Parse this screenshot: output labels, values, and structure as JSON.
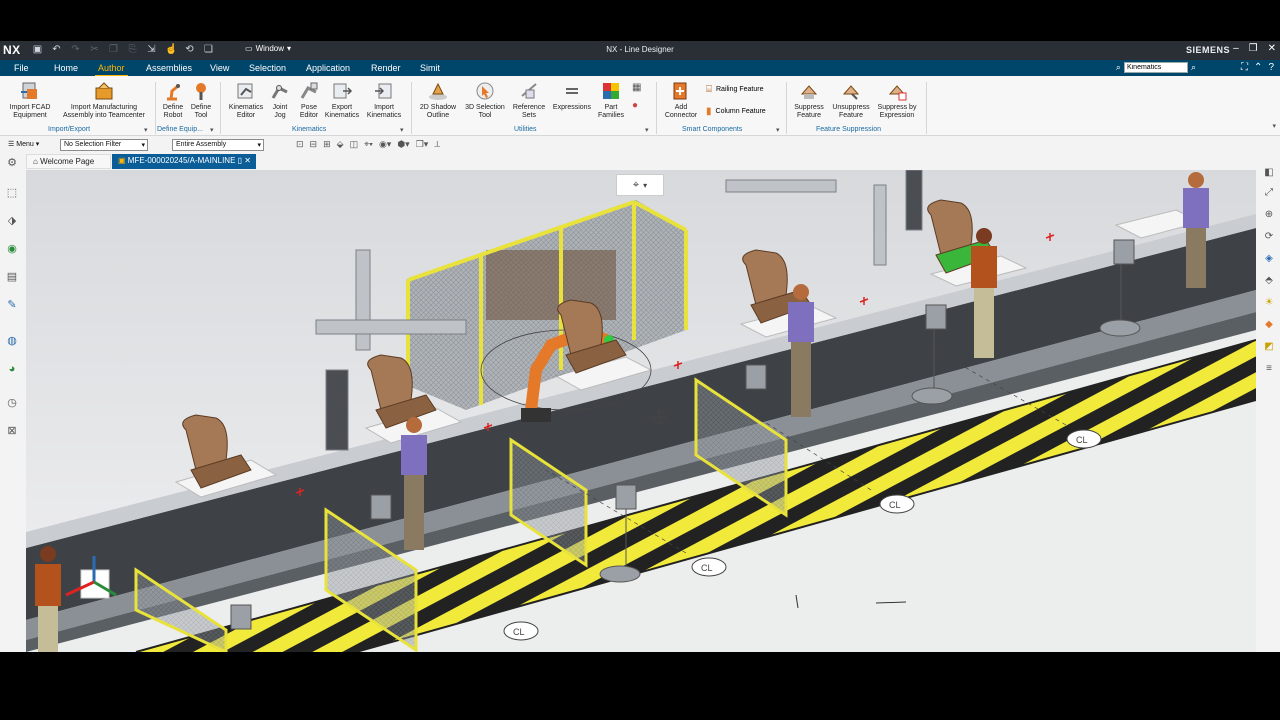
{
  "titlebar": {
    "logo": "NX",
    "window_menu": "Window",
    "title": "NX - Line Designer",
    "brand": "SIEMENS"
  },
  "tabs": [
    {
      "label": "File"
    },
    {
      "label": "Home"
    },
    {
      "label": "Author"
    },
    {
      "label": "Assemblies"
    },
    {
      "label": "View"
    },
    {
      "label": "Selection"
    },
    {
      "label": "Application"
    },
    {
      "label": "Render"
    },
    {
      "label": "Simit"
    }
  ],
  "search": {
    "value": "Kinematics"
  },
  "ribbon": {
    "buttons": [
      {
        "line1": "Import FCAD",
        "line2": "Equipment"
      },
      {
        "line1": "Import Manufacturing",
        "line2": "Assembly into Teamcenter"
      },
      {
        "line1": "Define",
        "line2": "Robot"
      },
      {
        "line1": "Define",
        "line2": "Tool"
      },
      {
        "line1": "Kinematics",
        "line2": "Editor"
      },
      {
        "line1": "Joint",
        "line2": "Jog"
      },
      {
        "line1": "Pose",
        "line2": "Editor"
      },
      {
        "line1": "Export",
        "line2": "Kinematics"
      },
      {
        "line1": "Import",
        "line2": "Kinematics"
      },
      {
        "line1": "2D Shadow",
        "line2": "Outline"
      },
      {
        "line1": "3D Selection",
        "line2": "Tool"
      },
      {
        "line1": "Reference",
        "line2": "Sets"
      },
      {
        "line1": "Expressions",
        "line2": ""
      },
      {
        "line1": "Part",
        "line2": "Families"
      },
      {
        "line1": "Add",
        "line2": "Connector"
      },
      {
        "line1": "Suppress",
        "line2": "Feature"
      },
      {
        "line1": "Unsuppress",
        "line2": "Feature"
      },
      {
        "line1": "Suppress by",
        "line2": "Expression"
      }
    ],
    "small_buttons": [
      "Railing Feature",
      "Column Feature"
    ],
    "groups": [
      "Import/Export",
      "Define Equip...",
      "Kinematics",
      "Utilities",
      "Smart Components",
      "Feature Suppression"
    ]
  },
  "toolbar2": {
    "menu": "Menu",
    "selection_filter": "No Selection Filter",
    "scope": "Entire Assembly"
  },
  "doc_tabs": [
    {
      "label": "Welcome Page"
    },
    {
      "label": "MFE-000020245/A-MAINLINE"
    }
  ],
  "scene": {
    "floor_labels": [
      "CL",
      "CL",
      "CL",
      "CL"
    ]
  },
  "colors": {
    "titlebar": "#2a2f35",
    "menubar": "#00466b",
    "active_tab": "#ffb400",
    "doc_tab_active": "#0a5d97",
    "hazard_yellow": "#f2ea3a"
  }
}
